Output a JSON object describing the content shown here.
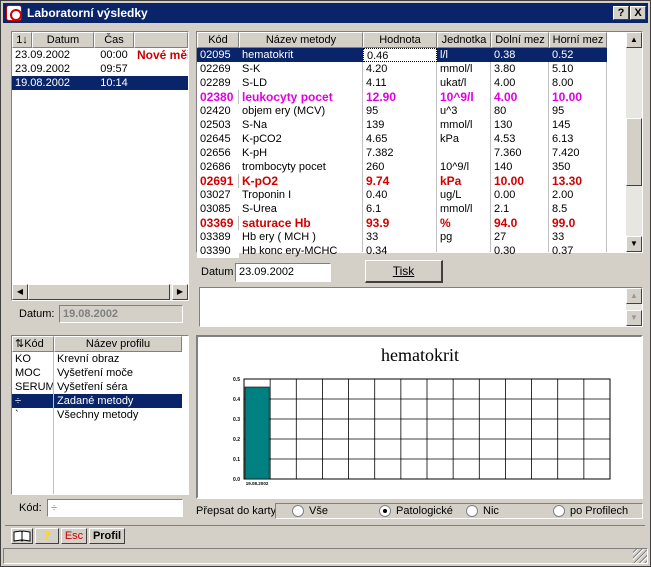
{
  "window": {
    "title": "Laboratorní výsledky",
    "help_label": "?",
    "close_label": "X"
  },
  "dates": {
    "header": {
      "sort_icon": "1↓",
      "date": "Datum",
      "time": "Čas"
    },
    "rows": [
      {
        "date": "23.09.2002",
        "time": "00:00",
        "note": "Nové měře",
        "selected": false
      },
      {
        "date": "23.09.2002",
        "time": "09:57",
        "note": "",
        "selected": false
      },
      {
        "date": "19.08.2002",
        "time": "10:14",
        "note": "",
        "selected": true
      }
    ],
    "datum_label": "Datum:",
    "datum_value": "19.08.2002"
  },
  "results": {
    "headers": {
      "code": "Kód",
      "name": "Název metody",
      "value": "Hodnota",
      "unit": "Jednotka",
      "low": "Dolní mez",
      "high": "Horní mez"
    },
    "rows": [
      {
        "code": "02095",
        "name": "hematokrit",
        "value": "0.46",
        "unit": "l/l",
        "low": "0.38",
        "high": "0.52",
        "style": "selected"
      },
      {
        "code": "02269",
        "name": "S-K",
        "value": "4.20",
        "unit": "mmol/l",
        "low": "3.80",
        "high": "5.10",
        "style": "normal"
      },
      {
        "code": "02289",
        "name": "S-LD",
        "value": "4.11",
        "unit": "ukat/l",
        "low": "4.00",
        "high": "8.00",
        "style": "normal"
      },
      {
        "code": "02380",
        "name": "leukocyty pocet",
        "value": "12.90",
        "unit": "10^9/l",
        "low": "4.00",
        "high": "10.00",
        "style": "magenta"
      },
      {
        "code": "02420",
        "name": "objem ery (MCV)",
        "value": "95",
        "unit": "u^3",
        "low": "80",
        "high": "95",
        "style": "normal"
      },
      {
        "code": "02503",
        "name": "S-Na",
        "value": "139",
        "unit": "mmol/l",
        "low": "130",
        "high": "145",
        "style": "normal"
      },
      {
        "code": "02645",
        "name": "K-pCO2",
        "value": "4.65",
        "unit": "kPa",
        "low": "4.53",
        "high": "6.13",
        "style": "normal"
      },
      {
        "code": "02656",
        "name": "K-pH",
        "value": "7.382",
        "unit": "",
        "low": "7.360",
        "high": "7.420",
        "style": "normal"
      },
      {
        "code": "02686",
        "name": "trombocyty pocet",
        "value": "260",
        "unit": "10^9/l",
        "low": "140",
        "high": "350",
        "style": "normal"
      },
      {
        "code": "02691",
        "name": "K-pO2",
        "value": "9.74",
        "unit": "kPa",
        "low": "10.00",
        "high": "13.30",
        "style": "red"
      },
      {
        "code": "03027",
        "name": "Troponin I",
        "value": "0.40",
        "unit": "ug/L",
        "low": "0.00",
        "high": "2.00",
        "style": "normal"
      },
      {
        "code": "03085",
        "name": "S-Urea",
        "value": "6.1",
        "unit": "mmol/l",
        "low": "2.1",
        "high": "8.5",
        "style": "normal"
      },
      {
        "code": "03369",
        "name": "saturace Hb",
        "value": "93.9",
        "unit": "%",
        "low": "94.0",
        "high": "99.0",
        "style": "red"
      },
      {
        "code": "03389",
        "name": "Hb ery ( MCH )",
        "value": "33",
        "unit": "pg",
        "low": "27",
        "high": "33",
        "style": "normal"
      },
      {
        "code": "03390",
        "name": "Hb konc ery-MCHC",
        "value": "0.34",
        "unit": "",
        "low": "0.30",
        "high": "0.37",
        "style": "normal"
      }
    ]
  },
  "datum2": {
    "label": "Datum",
    "value": "23.09.2002"
  },
  "print_button": "Tisk",
  "profiles": {
    "headers": {
      "code": "Kód",
      "name": "Název profilu"
    },
    "rows": [
      {
        "code": "KO",
        "name": "Krevní obraz",
        "selected": false
      },
      {
        "code": "MOC",
        "name": "Vyšetření moče",
        "selected": false
      },
      {
        "code": "SERUM",
        "name": "Vyšetření séra",
        "selected": false
      },
      {
        "code": "÷",
        "name": "Zadané metody",
        "selected": true
      },
      {
        "code": "`",
        "name": "Všechny metody",
        "selected": false
      }
    ],
    "kod_label": "Kód:",
    "kod_value": "÷"
  },
  "chart_data": {
    "type": "bar",
    "title": "hematokrit",
    "categories": [
      "19.08.2002"
    ],
    "values": [
      0.46
    ],
    "ylim": [
      0,
      0.5
    ],
    "yticks": [
      "0.0",
      "0.1",
      "0.2",
      "0.3",
      "0.4",
      "0.5"
    ],
    "grid": true,
    "bar_color": "#008080"
  },
  "prepsat": {
    "label": "Přepsat do karty",
    "options": [
      {
        "label": "Vše",
        "checked": false
      },
      {
        "label": "Patologické",
        "checked": true
      },
      {
        "label": "Nic",
        "checked": false
      },
      {
        "label": "po Profilech",
        "checked": false
      }
    ]
  },
  "statusbar": {
    "book_icon": "book-icon",
    "help_label": "?",
    "esc_label": "Esc",
    "profil_label": "Profil"
  }
}
